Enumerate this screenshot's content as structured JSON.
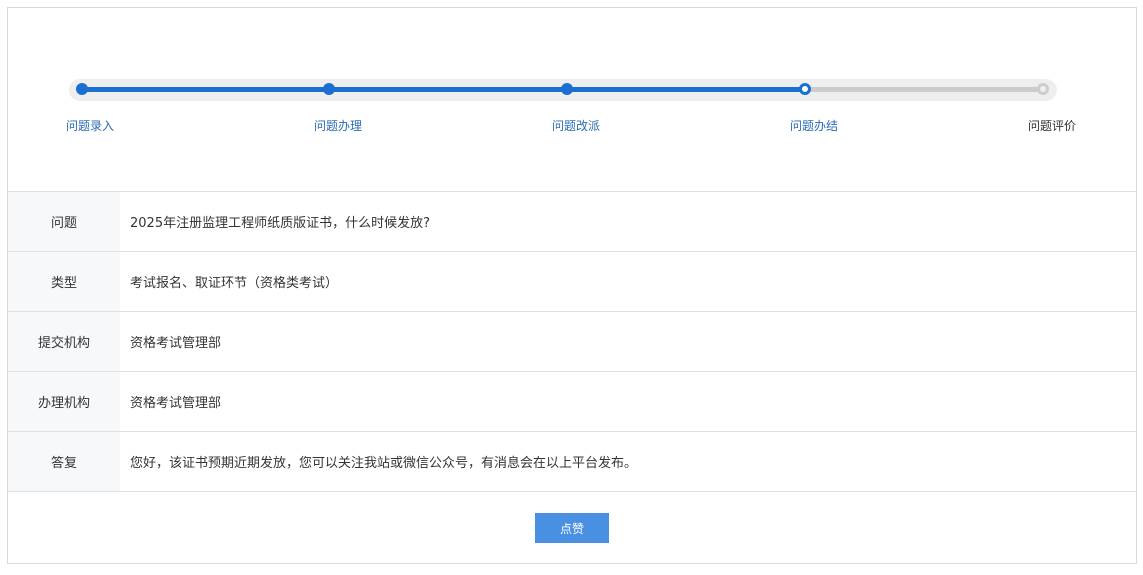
{
  "progress": {
    "steps": [
      {
        "label": "问题录入",
        "state": "done"
      },
      {
        "label": "问题办理",
        "state": "done"
      },
      {
        "label": "问题改派",
        "state": "done"
      },
      {
        "label": "问题办结",
        "state": "current"
      },
      {
        "label": "问题评价",
        "state": "todo"
      }
    ]
  },
  "info": {
    "rows": [
      {
        "label": "问题",
        "value": "2025年注册监理工程师纸质版证书，什么时候发放?"
      },
      {
        "label": "类型",
        "value": "考试报名、取证环节（资格类考试）"
      },
      {
        "label": "提交机构",
        "value": "资格考试管理部"
      },
      {
        "label": "办理机构",
        "value": "资格考试管理部"
      },
      {
        "label": "答复",
        "value": "您好，该证书预期近期发放，您可以关注我站或微信公众号，有消息会在以上平台发布。"
      }
    ]
  },
  "actions": {
    "like_label": "点赞"
  },
  "colors": {
    "accent": "#1a6fd0",
    "button": "#4a90e2",
    "pending": "#cccccc"
  }
}
